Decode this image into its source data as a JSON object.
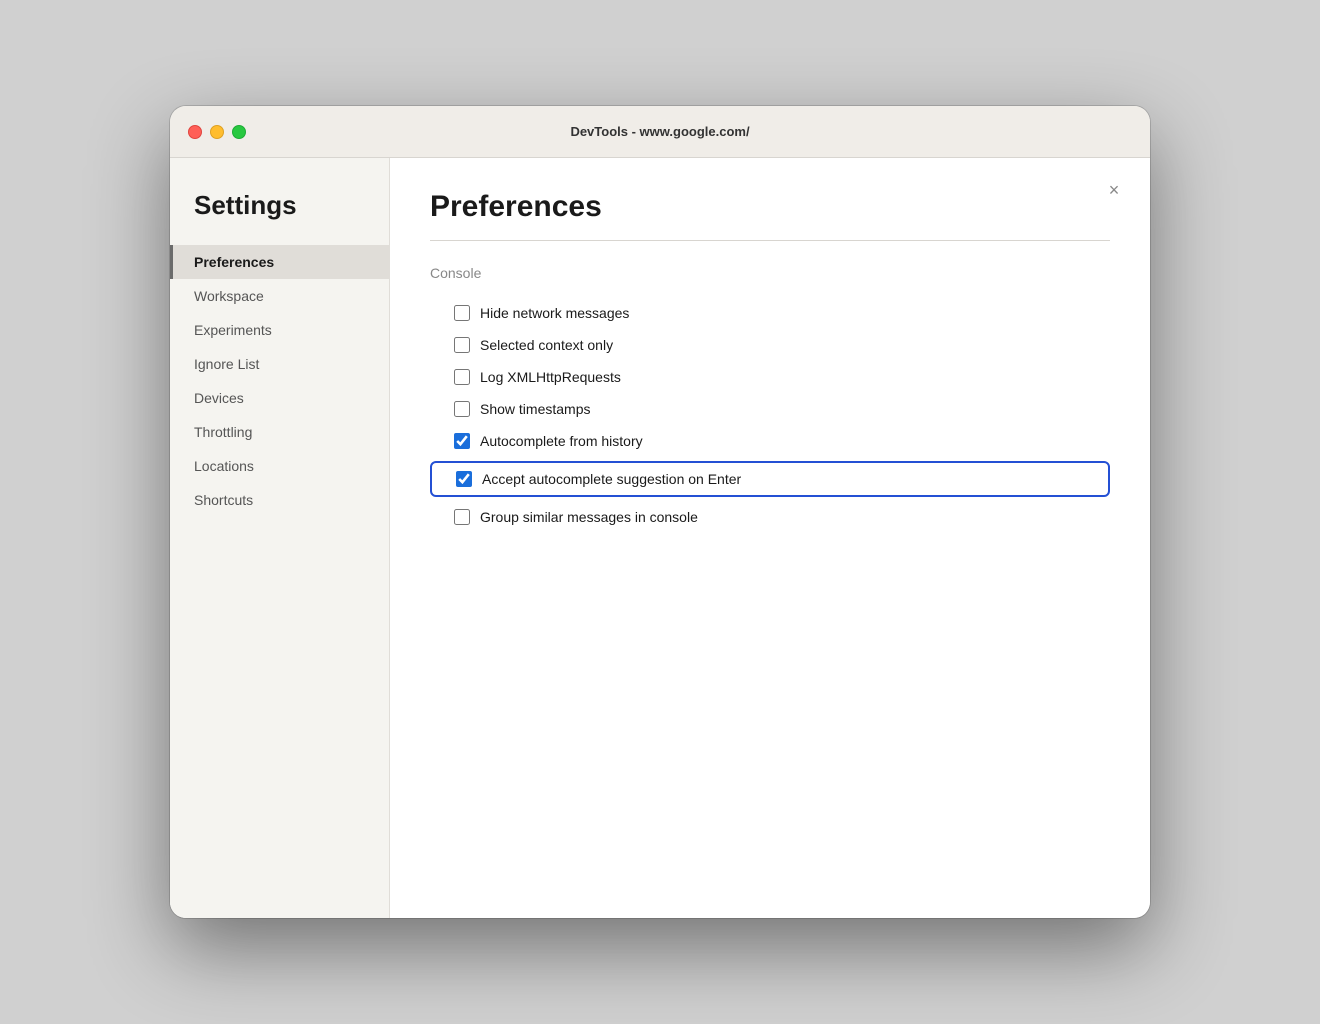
{
  "window": {
    "title": "DevTools - www.google.com/"
  },
  "sidebar": {
    "heading": "Settings",
    "items": [
      {
        "id": "preferences",
        "label": "Preferences",
        "active": true
      },
      {
        "id": "workspace",
        "label": "Workspace",
        "active": false
      },
      {
        "id": "experiments",
        "label": "Experiments",
        "active": false
      },
      {
        "id": "ignore-list",
        "label": "Ignore List",
        "active": false
      },
      {
        "id": "devices",
        "label": "Devices",
        "active": false
      },
      {
        "id": "throttling",
        "label": "Throttling",
        "active": false
      },
      {
        "id": "locations",
        "label": "Locations",
        "active": false
      },
      {
        "id": "shortcuts",
        "label": "Shortcuts",
        "active": false
      }
    ]
  },
  "main": {
    "title": "Preferences",
    "close_label": "×",
    "sections": [
      {
        "id": "console",
        "title": "Console",
        "checkboxes": [
          {
            "id": "hide-network",
            "label": "Hide network messages",
            "checked": false,
            "highlighted": false
          },
          {
            "id": "selected-context",
            "label": "Selected context only",
            "checked": false,
            "highlighted": false
          },
          {
            "id": "log-xmlhttp",
            "label": "Log XMLHttpRequests",
            "checked": false,
            "highlighted": false
          },
          {
            "id": "show-timestamps",
            "label": "Show timestamps",
            "checked": false,
            "highlighted": false
          },
          {
            "id": "autocomplete-history",
            "label": "Autocomplete from history",
            "checked": true,
            "highlighted": false
          },
          {
            "id": "autocomplete-enter",
            "label": "Accept autocomplete suggestion on Enter",
            "checked": true,
            "highlighted": true
          },
          {
            "id": "group-similar",
            "label": "Group similar messages in console",
            "checked": false,
            "highlighted": false
          }
        ]
      }
    ]
  }
}
